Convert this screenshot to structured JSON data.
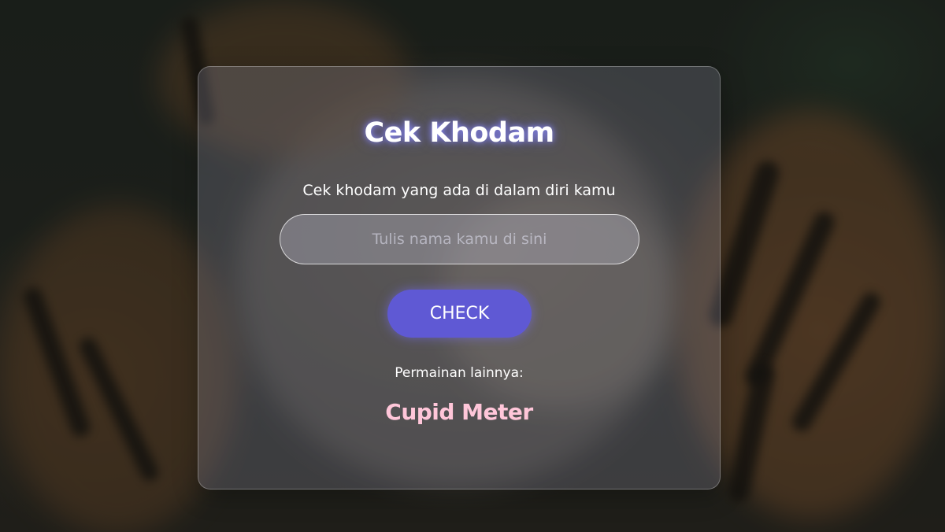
{
  "card": {
    "title": "Cek Khodam",
    "subtitle": "Cek khodam yang ada di dalam diri kamu",
    "name_input": {
      "value": "",
      "placeholder": "Tulis nama kamu di sini"
    },
    "check_button_label": "CHECK",
    "other_games_label": "Permainan lainnya:",
    "other_game_link": "Cupid Meter"
  },
  "colors": {
    "button_bg": "#5f59d4",
    "link_color": "#ffc6d9",
    "card_bg": "rgba(150,150,175,0.26)"
  }
}
